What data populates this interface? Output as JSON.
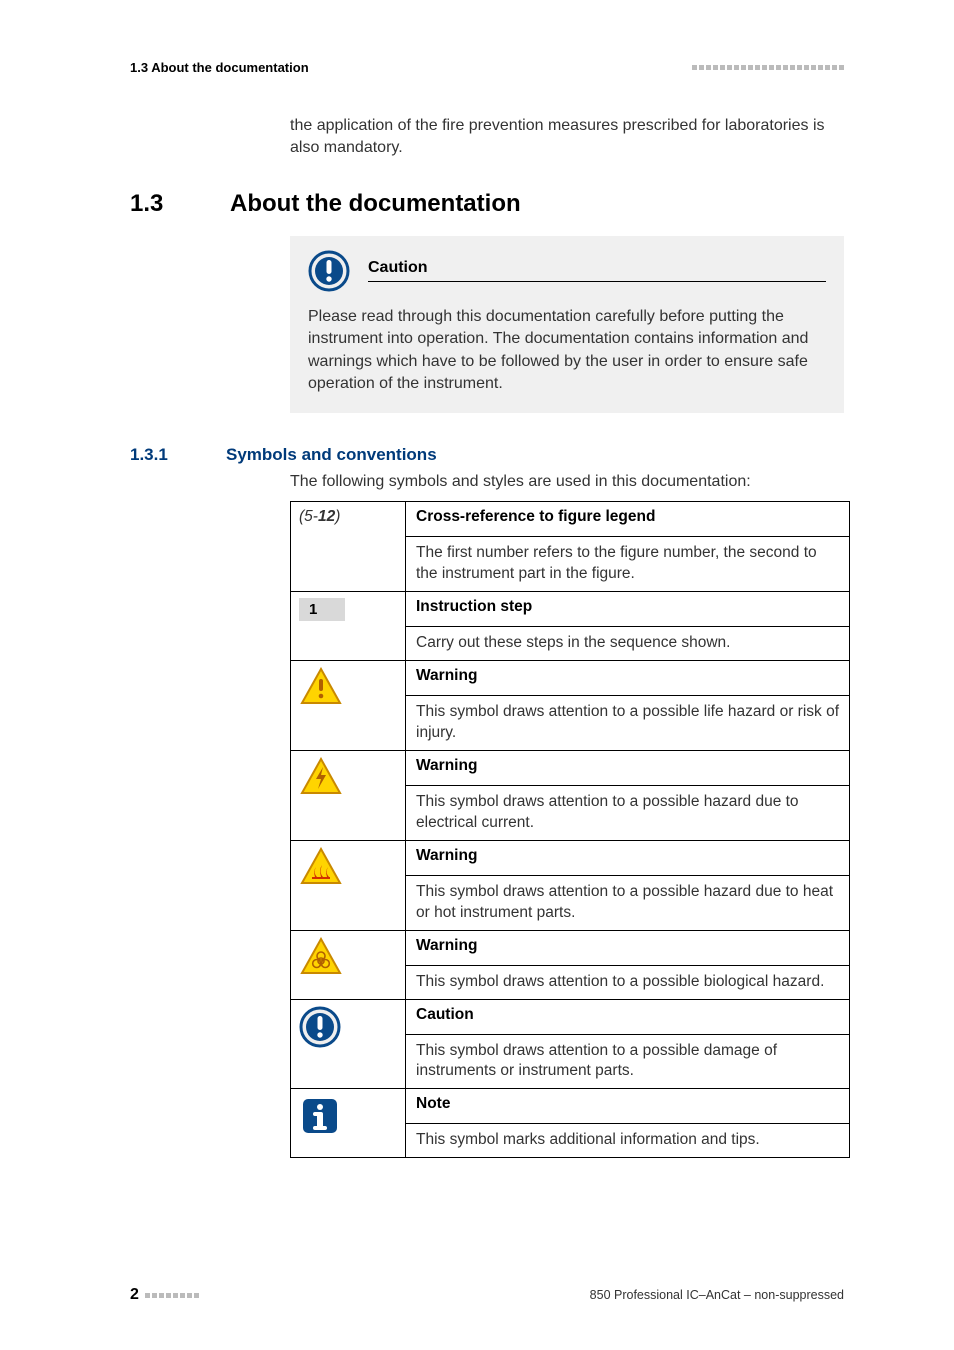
{
  "header": {
    "left": "1.3 About the documentation"
  },
  "intro_paragraph": "the application of the fire prevention measures prescribed for laboratories is also mandatory.",
  "section": {
    "number": "1.3",
    "title": "About the documentation"
  },
  "caution_box": {
    "title": "Caution",
    "body": "Please read through this documentation carefully before putting the instrument into operation. The documentation contains information and warnings which have to be followed by the user in order to ensure safe operation of the instrument."
  },
  "subsection": {
    "number": "1.3.1",
    "title": "Symbols and conventions"
  },
  "table_intro": "The following symbols and styles are used in this documentation:",
  "rows": {
    "crossref": {
      "label_prefix": "(5-",
      "label_bold": "12",
      "label_suffix": ")",
      "title": "Cross-reference to figure legend",
      "desc": "The first number refers to the figure number, the second to the instrument part in the figure."
    },
    "step": {
      "badge": "1",
      "title": "Instruction step",
      "desc": "Carry out these steps in the sequence shown."
    },
    "warn_life": {
      "title": "Warning",
      "desc": "This symbol draws attention to a possible life hazard or risk of injury."
    },
    "warn_elec": {
      "title": "Warning",
      "desc": "This symbol draws attention to a possible hazard due to electrical current."
    },
    "warn_heat": {
      "title": "Warning",
      "desc": "This symbol draws attention to a possible hazard due to heat or hot instrument parts."
    },
    "warn_bio": {
      "title": "Warning",
      "desc": "This symbol draws attention to a possible biological hazard."
    },
    "caution": {
      "title": "Caution",
      "desc": "This symbol draws attention to a possible damage of instruments or instrument parts."
    },
    "note": {
      "title": "Note",
      "desc": "This symbol marks additional information and tips."
    }
  },
  "footer": {
    "page": "2",
    "right": "850 Professional IC–AnCat – non-suppressed"
  }
}
